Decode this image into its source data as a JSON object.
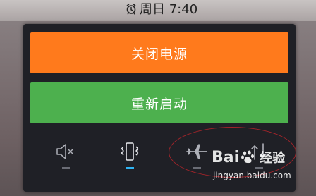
{
  "status_bar": {
    "alarm_icon": "alarm-clock-icon",
    "time": "周日 7:40"
  },
  "power_menu": {
    "power_off_label": "关闭电源",
    "restart_label": "重新启动",
    "colors": {
      "power_off": "#ff7a1c",
      "restart": "#4db04e",
      "panel": "#1f2026",
      "active_indicator": "#2fb3f2"
    },
    "sound_modes": [
      {
        "icon": "mute-icon",
        "active": false
      },
      {
        "icon": "vibrate-icon",
        "active": true
      },
      {
        "icon": "airplane-mode-icon",
        "active": false
      },
      {
        "icon": "mobile-data-icon",
        "active": false
      }
    ]
  },
  "watermark": {
    "brand_left": "Bai",
    "brand_right": "经验",
    "url": "jingyan.baidu.com",
    "paw_icon": "baidu-paw-icon"
  },
  "annotation": {
    "type": "red-ellipse-highlight",
    "color": "#a3242a"
  }
}
